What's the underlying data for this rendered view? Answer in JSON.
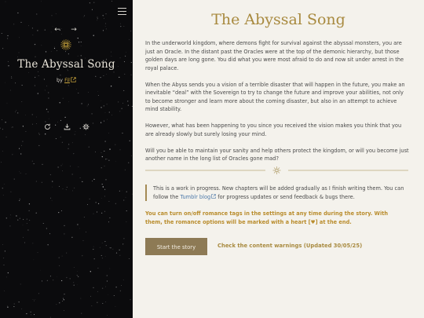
{
  "sidebar": {
    "menu_icon": "hamburger-menu-icon",
    "prev_label": "←",
    "next_label": "→",
    "title": "The Abyssal Song",
    "by_label": "by",
    "author": "Fil",
    "author_link_icon": "external-link-icon",
    "tools": [
      {
        "name": "restart-icon"
      },
      {
        "name": "download-icon"
      },
      {
        "name": "settings-icon"
      }
    ]
  },
  "main": {
    "title": "The Abyssal Song",
    "paragraphs": [
      "In the underworld kingdom, where demons fight for survival against the abyssal monsters, you are just an Oracle. In the distant past the Oracles were at the top of the demonic hierarchy, but those golden days are long gone. You did what you were most afraid to do and now sit under arrest in the royal palace.",
      "When the Abyss sends you a vision of a terrible disaster that will happen in the future, you make an inevitable “deal” with the Sovereign to try to change the future and improve your abilities, not only to become stronger and learn more about the coming disaster, but also in an attempt to achieve mind stability.",
      "However, what has been happening to you since you received the vision makes you think that you are already slowly but surely losing your mind.",
      "Will you be able to maintain your sanity and help others protect the kingdom, or will you become just another name in the long list of Oracles gone mad?"
    ],
    "callout": {
      "text_before": "This is a work in progress. New chapters will be added gradually as I finish writing them. You can follow the ",
      "link_text": "Tumblr blog",
      "text_after": " for progress updates or send feedback & bugs there."
    },
    "romance_note": "You can turn on/off romance tags in the settings at any time during the story. With them, the romance options will be marked with a heart [♥] at the end.",
    "start_button": "Start the story",
    "warnings_link": "Check the content warnings (Updated 30/05/25)"
  },
  "colors": {
    "accent_gold": "#a88a3f",
    "button_bg": "#8d7a55",
    "sidebar_bg": "#0b0b0d",
    "main_bg": "#f4f2ec",
    "link_blue": "#4b78a9",
    "romance_note": "#b98c2c"
  }
}
